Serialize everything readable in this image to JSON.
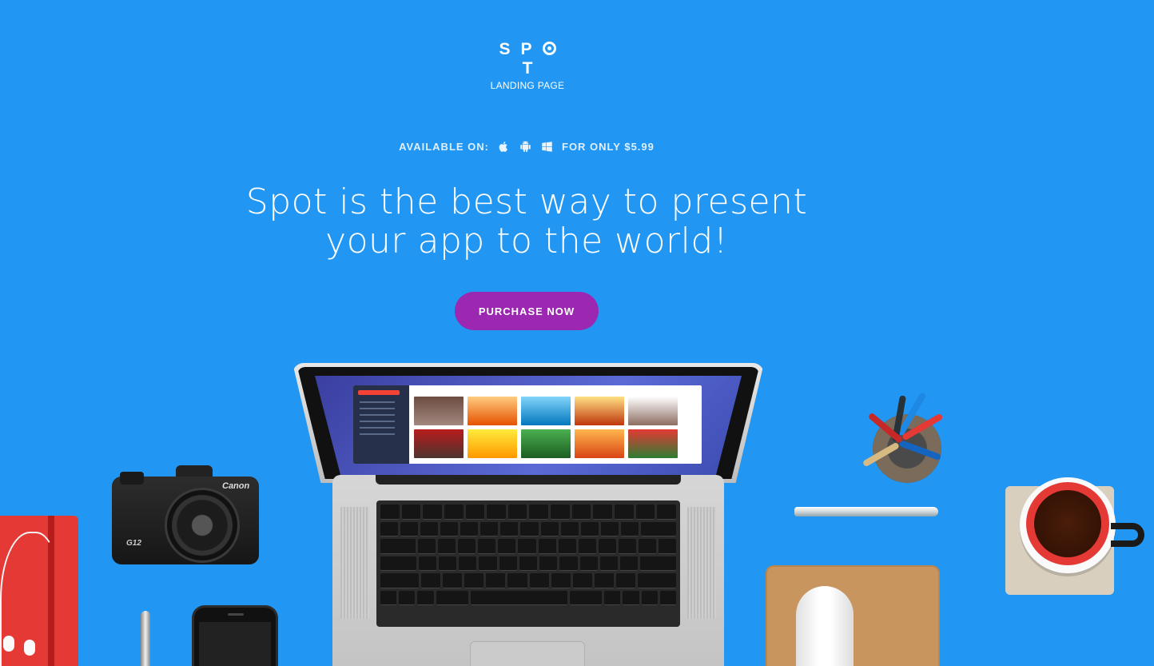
{
  "brand": {
    "name_letters": [
      "S",
      "P",
      "O",
      "T"
    ],
    "subtitle": "LANDING PAGE"
  },
  "availability": {
    "prefix": "AVAILABLE ON:",
    "platforms": [
      "apple-icon",
      "android-icon",
      "windows-icon"
    ],
    "price_text": "FOR ONLY $5.99"
  },
  "hero": {
    "headline_line1": "Spot is the best way to present",
    "headline_line2": "your app to the world!",
    "cta_label": "PURCHASE NOW"
  },
  "devices": {
    "camera_brand": "Canon",
    "camera_model": "G12"
  },
  "colors": {
    "background": "#2196f3",
    "cta": "#9c27b0"
  }
}
